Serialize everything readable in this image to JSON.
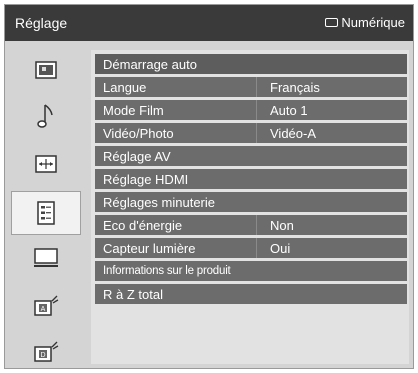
{
  "header": {
    "title": "Réglage",
    "source": "Numérique"
  },
  "colors": {
    "header_bg": "#3a3a3a",
    "row_bg": "#6c6c6c",
    "panel_bg": "#e2e2e2",
    "sidebar_bg": "#d4d4d4"
  },
  "sidebar": {
    "items": [
      {
        "icon": "picture-icon"
      },
      {
        "icon": "music-note-icon"
      },
      {
        "icon": "screen-adjust-icon"
      },
      {
        "icon": "setup-list-icon",
        "selected": true
      },
      {
        "icon": "monitor-icon"
      },
      {
        "icon": "analog-antenna-icon"
      },
      {
        "icon": "digital-antenna-icon"
      }
    ]
  },
  "menu": {
    "rows": [
      {
        "label": "Démarrage auto",
        "value": ""
      },
      {
        "label": "Langue",
        "value": "Français"
      },
      {
        "label": "Mode Film",
        "value": "Auto 1"
      },
      {
        "label": "Vidéo/Photo",
        "value": "Vidéo-A"
      },
      {
        "label": "Réglage AV",
        "value": ""
      },
      {
        "label": "Réglage HDMI",
        "value": ""
      },
      {
        "label": "Réglages minuterie",
        "value": ""
      },
      {
        "label": "Eco d'énergie",
        "value": "Non"
      },
      {
        "label": "Capteur lumière",
        "value": "Oui"
      },
      {
        "label": "Informations sur le produit",
        "value": ""
      },
      {
        "label": "R à Z total",
        "value": ""
      }
    ]
  }
}
